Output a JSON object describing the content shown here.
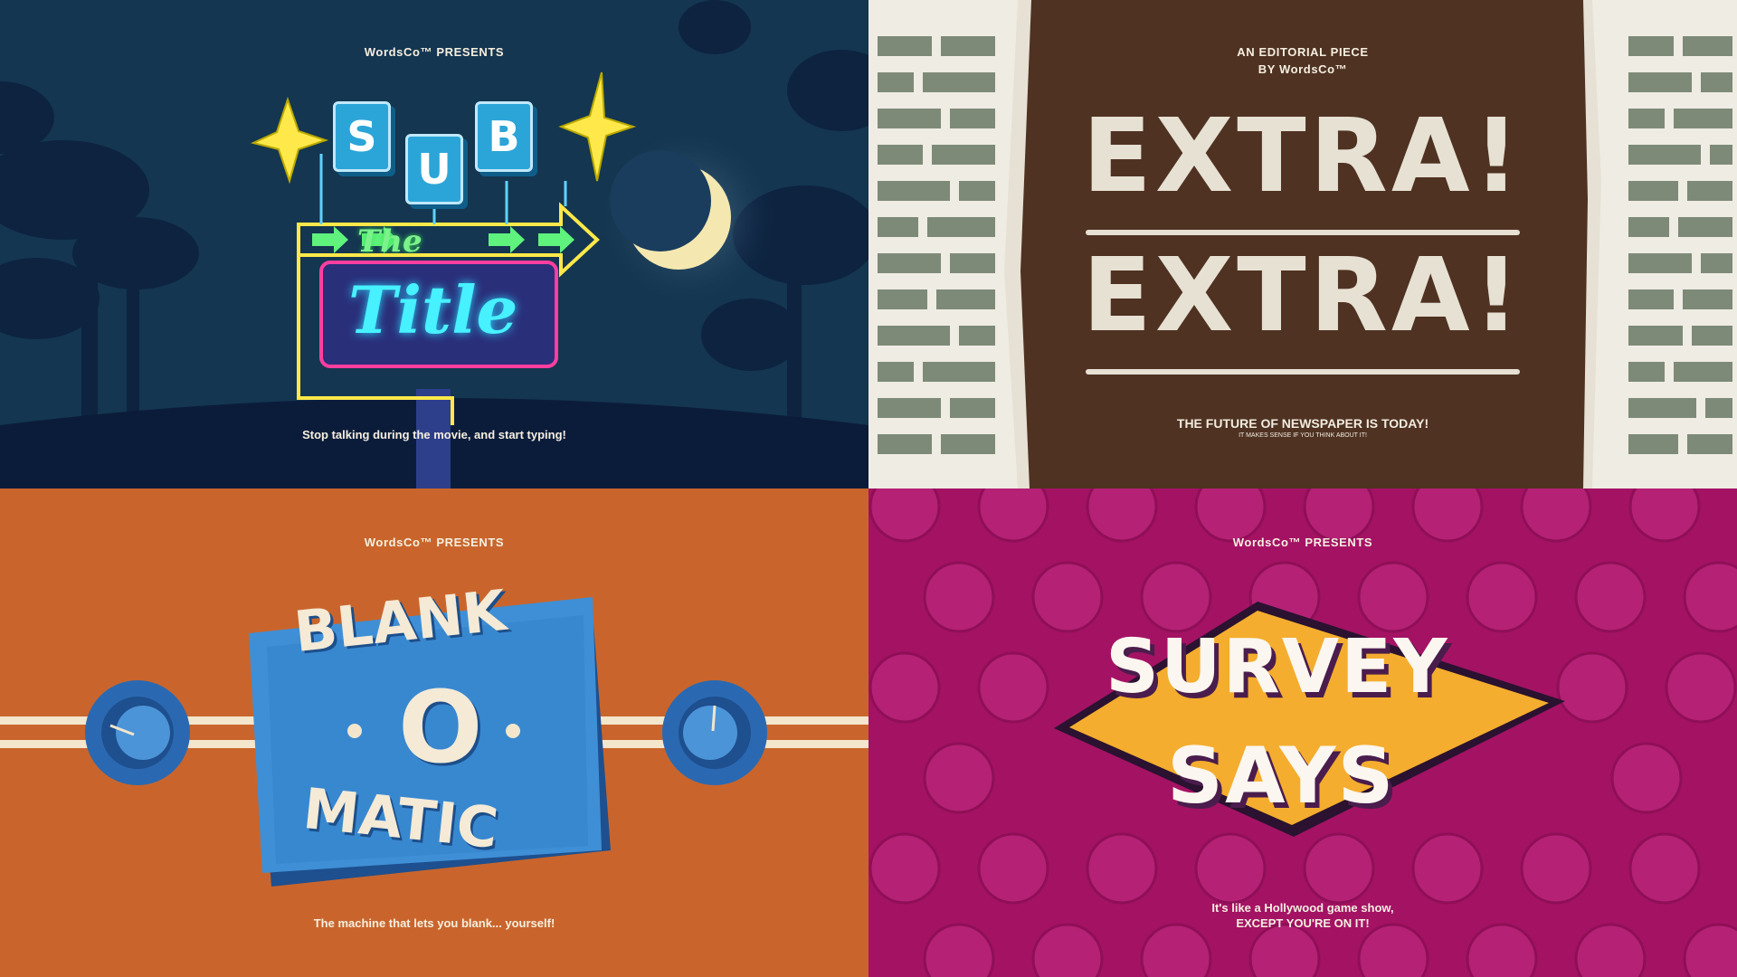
{
  "panels": {
    "sub_the_title": {
      "presents": "WordsCo™ PRESENTS",
      "title_letters": [
        "S",
        "U",
        "B"
      ],
      "title_middle": "The",
      "title_bottom": "Title",
      "tagline": "Stop talking during the movie, and start typing!"
    },
    "extra_extra": {
      "presents_line1": "AN EDITORIAL PIECE",
      "presents_line2": "BY WordsCo™",
      "title_line1": "EXTRA!",
      "title_line2": "EXTRA!",
      "tagline": "THE FUTURE OF NEWSPAPER IS TODAY!",
      "fine_print": "IT MAKES SENSE IF YOU THINK ABOUT IT!"
    },
    "blank_o_matic": {
      "presents": "WordsCo™ PRESENTS",
      "title_top": "BLANK",
      "title_middle": "O",
      "title_bottom": "MATIC",
      "tagline": "The machine that lets you blank... yourself!"
    },
    "survey_says": {
      "presents": "WordsCo™ PRESENTS",
      "title_top": "SURVEY",
      "title_bottom": "SAYS",
      "tagline_line1": "It's like a Hollywood game show,",
      "tagline_line2": "EXCEPT YOU'RE ON IT!"
    }
  },
  "colors": {
    "night_sky": "#143650",
    "newspaper_brown": "#4f3222",
    "retro_orange": "#c9652c",
    "game_show_magenta": "#a41264"
  }
}
